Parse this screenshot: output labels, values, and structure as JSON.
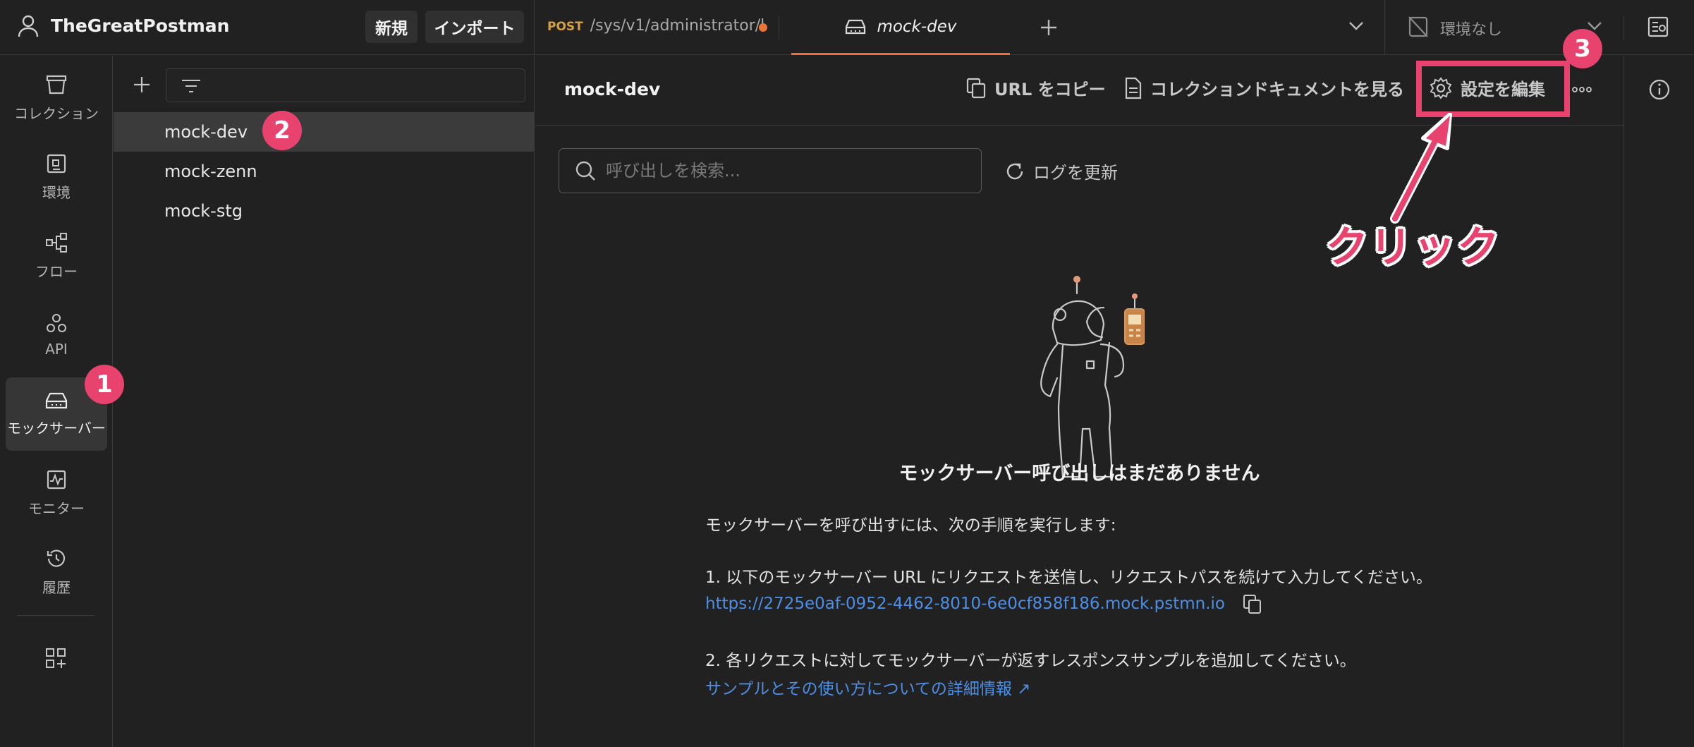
{
  "workspace": {
    "name": "TheGreatPostman",
    "new_label": "新規",
    "import_label": "インポート"
  },
  "tabs": {
    "request": {
      "method": "POST",
      "path": "/sys/v1/administrator/l"
    },
    "active": {
      "label": "mock-dev"
    }
  },
  "environment": {
    "label": "環境なし"
  },
  "rail": [
    {
      "label": "コレクション"
    },
    {
      "label": "環境"
    },
    {
      "label": "フロー"
    },
    {
      "label": "API"
    },
    {
      "label": "モックサーバー"
    },
    {
      "label": "モニター"
    },
    {
      "label": "履歴"
    }
  ],
  "list": {
    "items": [
      "mock-dev",
      "mock-zenn",
      "mock-stg"
    ]
  },
  "main": {
    "title": "mock-dev",
    "copy_url_label": "URL をコピー",
    "view_docs_label": "コレクションドキュメントを見る",
    "edit_settings_label": "設定を編集",
    "search_placeholder": "呼び出しを検索...",
    "refresh_label": "ログを更新",
    "empty_title": "モックサーバー呼び出しはまだありません",
    "intro": "モックサーバーを呼び出すには、次の手順を実行します:",
    "step1": "1. 以下のモックサーバー URL にリクエストを送信し、リクエストパスを続けて入力してください。",
    "mock_url": "https://2725e0af-0952-4462-8010-6e0cf858f186.mock.pstmn.io",
    "step2": "2. 各リクエストに対してモックサーバーが返すレスポンスサンプルを追加してください。",
    "learn_more": "サンプルとその使い方についての詳細情報 ↗"
  },
  "annotations": {
    "badge1": "1",
    "badge2": "2",
    "badge3": "3",
    "click_label": "クリック",
    "accent_color": "#e8436e"
  },
  "colors": {
    "background": "#212121",
    "selected": "#3b3b3b",
    "tab_accent": "#f26b3a",
    "link": "#4d8fe6"
  }
}
